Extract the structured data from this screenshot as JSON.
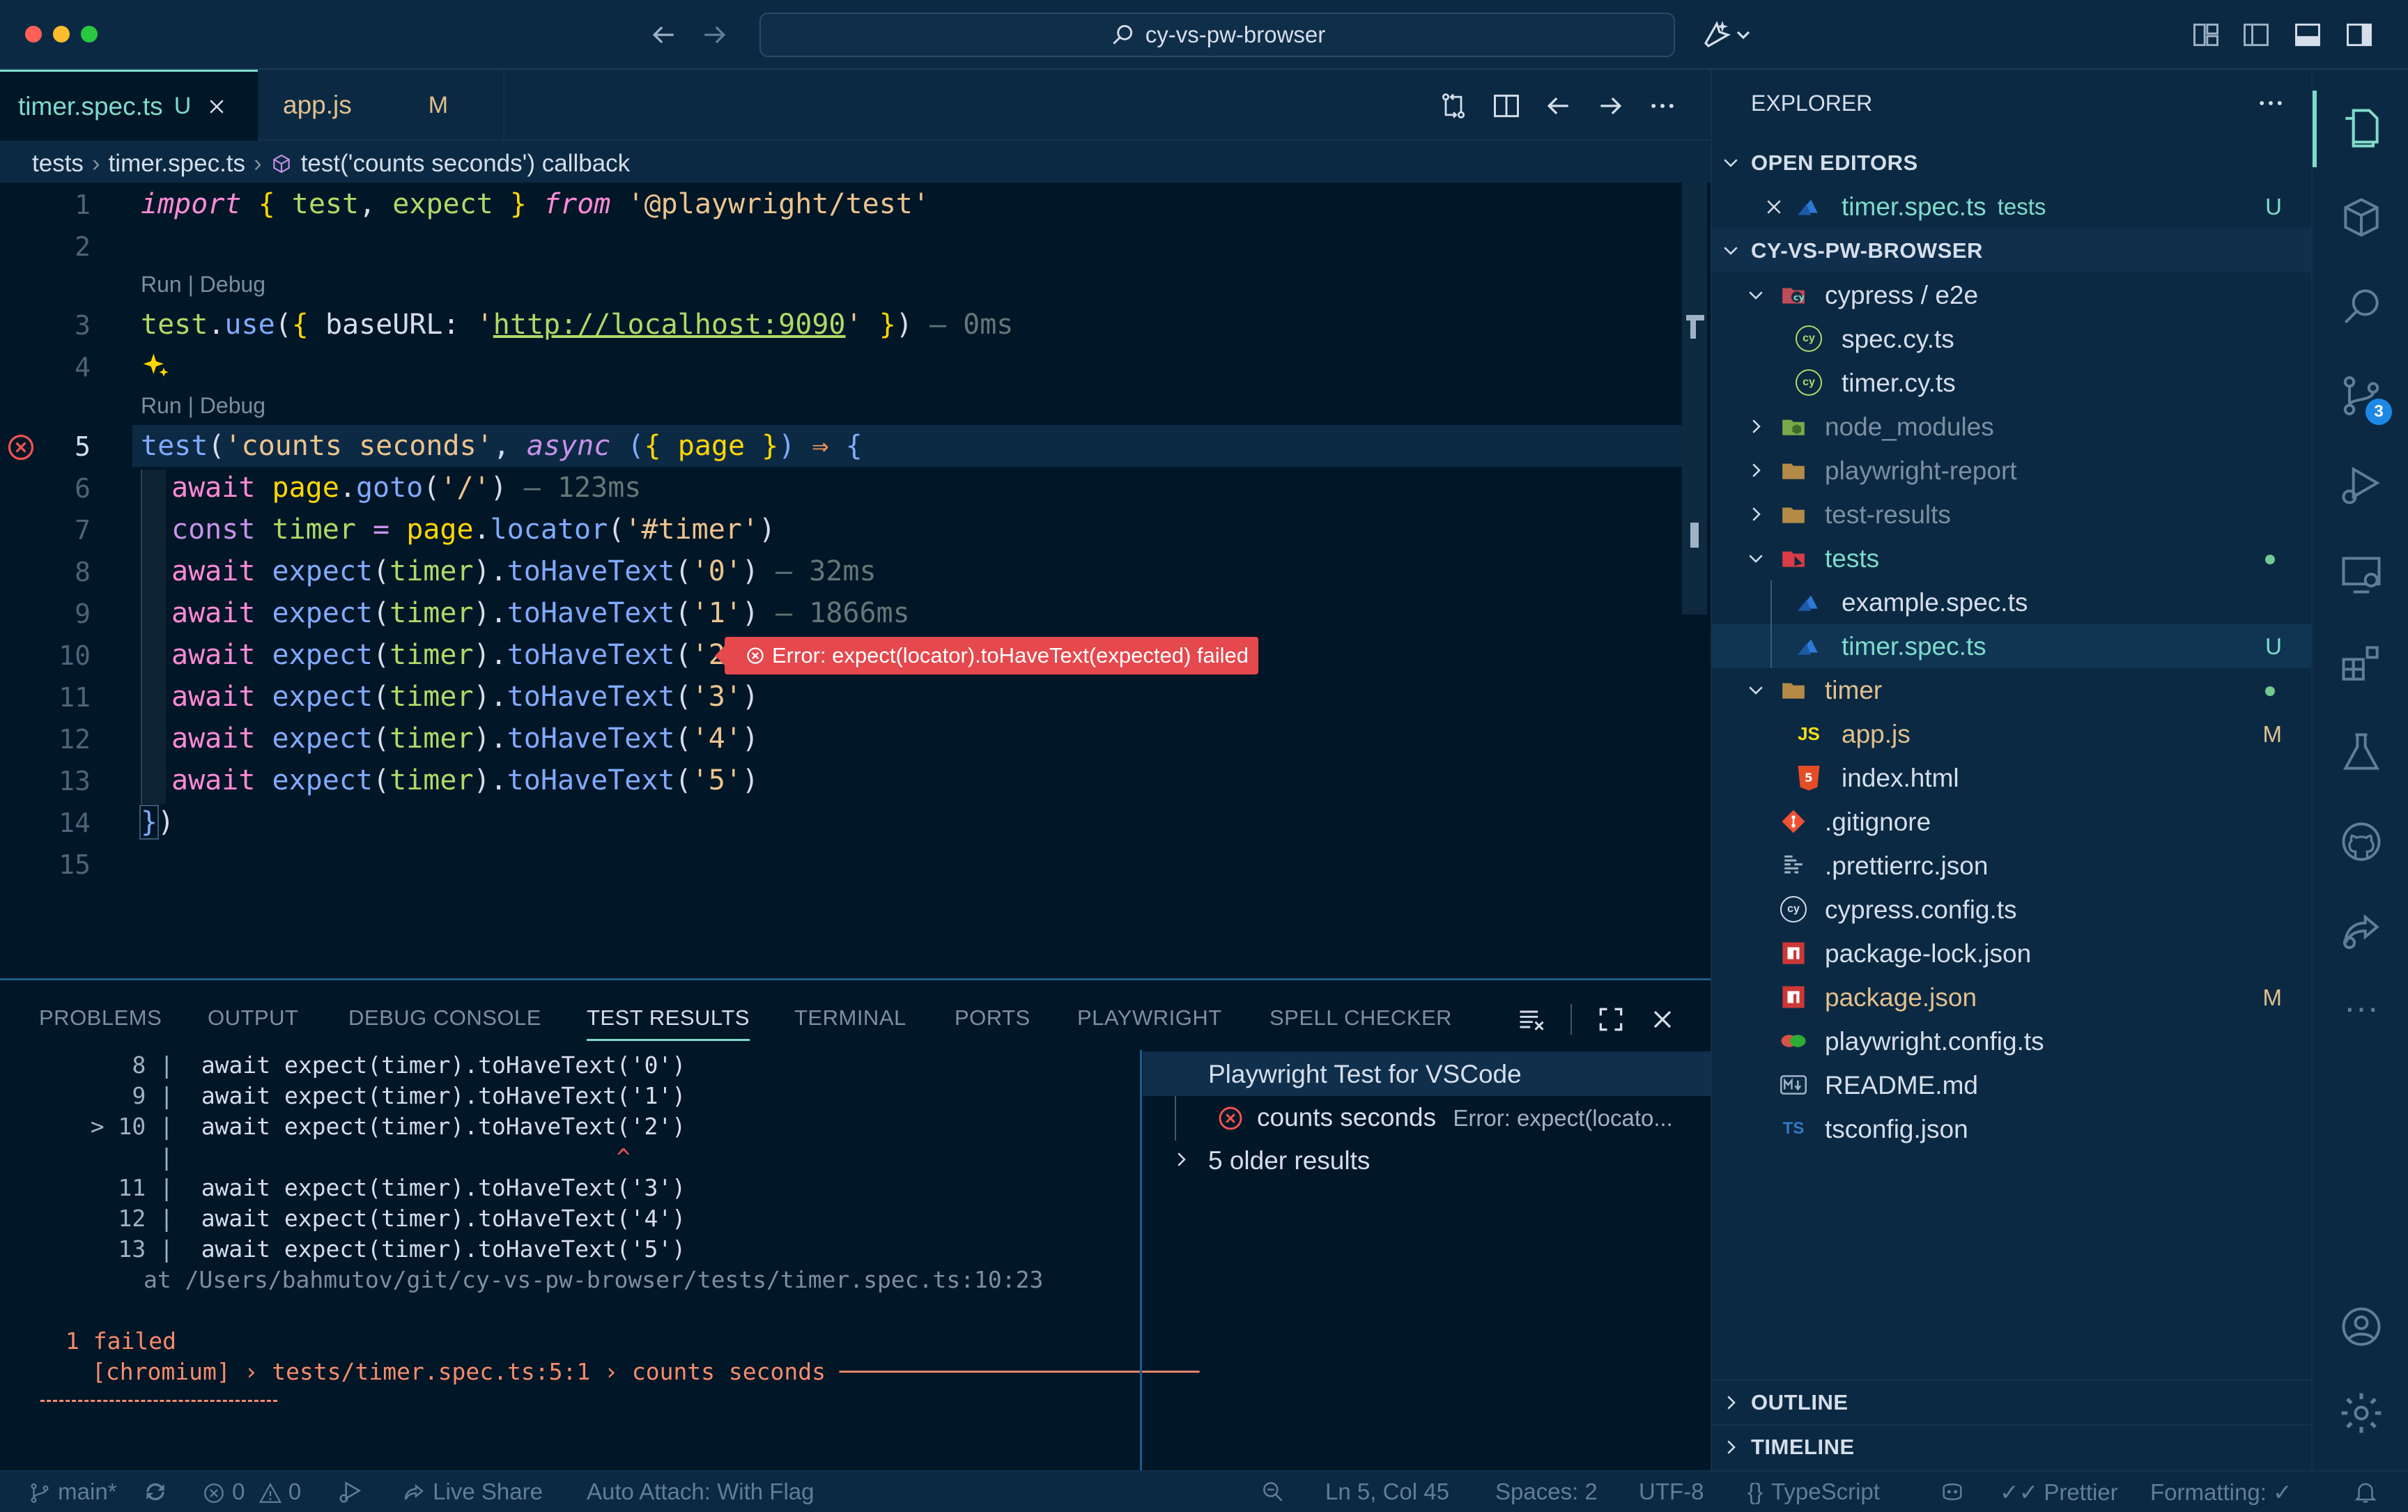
{
  "window": {
    "search_text": "cy-vs-pw-browser"
  },
  "tabs": [
    {
      "label": "timer.spec.ts",
      "status": "U",
      "active": true
    },
    {
      "label": "app.js",
      "status": "M",
      "active": false
    }
  ],
  "breadcrumb": [
    "tests",
    "timer.spec.ts",
    "test('counts seconds') callback"
  ],
  "codelens": "Run | Debug",
  "editor": {
    "line_numbers": [
      "1",
      "2",
      "3",
      "4",
      "5",
      "6",
      "7",
      "8",
      "9",
      "10",
      "11",
      "12",
      "13",
      "14",
      "15"
    ],
    "inline_error": "Error: expect(locator).toHaveText(expected) failed",
    "durations": {
      "line3": " — 0ms",
      "line6": " — 123ms",
      "line8": " — 32ms",
      "line9": " — 1866ms"
    }
  },
  "panel": {
    "tabs": [
      "PROBLEMS",
      "OUTPUT",
      "DEBUG CONSOLE",
      "TEST RESULTS",
      "TERMINAL",
      "PORTS",
      "PLAYWRIGHT",
      "SPELL CHECKER"
    ],
    "active_tab": "TEST RESULTS",
    "output_lines": [
      {
        "gutter": "    8 |",
        "code": "  await expect(timer).toHaveText('0')"
      },
      {
        "gutter": "    9 |",
        "code": "  await expect(timer).toHaveText('1')"
      },
      {
        "gutter": "  > 10 |",
        "code": "  await expect(timer).toHaveText('2')"
      },
      {
        "gutter": "       |",
        "code": "                                ^"
      },
      {
        "gutter": "    11 |",
        "code": "  await expect(timer).toHaveText('3')"
      },
      {
        "gutter": "    12 |",
        "code": "  await expect(timer).toHaveText('4')"
      },
      {
        "gutter": "    13 |",
        "code": "  await expect(timer).toHaveText('5')"
      }
    ],
    "at_line": "at /Users/bahmutov/git/cy-vs-pw-browser/tests/timer.spec.ts:10:23",
    "failed_summary": "1 failed",
    "failed_detail": "[chromium] › tests/timer.spec.ts:5:1 › counts seconds ──────────────────────────",
    "results_tree": {
      "root": "Playwright Test for VSCode",
      "item_name": "counts seconds",
      "item_error": "Error: expect(locato...",
      "older": "5 older results"
    }
  },
  "explorer": {
    "title": "EXPLORER",
    "open_editors_label": "OPEN EDITORS",
    "open_editor": {
      "name": "timer.spec.ts",
      "folder": "tests",
      "status": "U"
    },
    "project_label": "CY-VS-PW-BROWSER",
    "tree": [
      {
        "name": "cypress / e2e",
        "depth": 0,
        "type": "folder-open",
        "icon": "cypress-folder-icon"
      },
      {
        "name": "spec.cy.ts",
        "depth": 1,
        "type": "file",
        "icon": "cypress-file-icon"
      },
      {
        "name": "timer.cy.ts",
        "depth": 1,
        "type": "file",
        "icon": "cypress-file-icon"
      },
      {
        "name": "node_modules",
        "depth": 0,
        "type": "folder-closed",
        "icon": "node-folder-icon"
      },
      {
        "name": "playwright-report",
        "depth": 0,
        "type": "folder-closed",
        "icon": "folder-icon"
      },
      {
        "name": "test-results",
        "depth": 0,
        "type": "folder-closed",
        "icon": "folder-icon"
      },
      {
        "name": "tests",
        "depth": 0,
        "type": "folder-open",
        "icon": "test-folder-icon",
        "status": "dot"
      },
      {
        "name": "example.spec.ts",
        "depth": 1,
        "type": "file",
        "icon": "playwright-icon"
      },
      {
        "name": "timer.spec.ts",
        "depth": 1,
        "type": "file",
        "icon": "playwright-icon",
        "status": "U",
        "selected": true
      },
      {
        "name": "timer",
        "depth": 0,
        "type": "folder-open",
        "icon": "folder-icon",
        "status": "dot"
      },
      {
        "name": "app.js",
        "depth": 1,
        "type": "file",
        "icon": "js-icon",
        "status": "M"
      },
      {
        "name": "index.html",
        "depth": 1,
        "type": "file",
        "icon": "html-icon"
      },
      {
        "name": ".gitignore",
        "depth": 0,
        "type": "file",
        "icon": "git-icon"
      },
      {
        "name": ".prettierrc.json",
        "depth": 0,
        "type": "file",
        "icon": "prettier-icon"
      },
      {
        "name": "cypress.config.ts",
        "depth": 0,
        "type": "file",
        "icon": "cypress-file-icon"
      },
      {
        "name": "package-lock.json",
        "depth": 0,
        "type": "file",
        "icon": "npm-icon"
      },
      {
        "name": "package.json",
        "depth": 0,
        "type": "file",
        "icon": "npm-icon",
        "status": "M"
      },
      {
        "name": "playwright.config.ts",
        "depth": 0,
        "type": "file",
        "icon": "playwright-config-icon"
      },
      {
        "name": "README.md",
        "depth": 0,
        "type": "file",
        "icon": "markdown-icon"
      },
      {
        "name": "tsconfig.json",
        "depth": 0,
        "type": "file",
        "icon": "ts-icon"
      }
    ],
    "outline_label": "OUTLINE",
    "timeline_label": "TIMELINE"
  },
  "activity": {
    "source_control_badge": "3"
  },
  "statusbar": {
    "branch": "main*",
    "errors": "0",
    "warnings": "0",
    "live_share": "Live Share",
    "auto_attach": "Auto Attach: With Flag",
    "position": "Ln 5, Col 45",
    "spaces": "Spaces: 2",
    "encoding": "UTF-8",
    "language": "TypeScript",
    "prettier": "Prettier",
    "formatting": "Formatting: ✓"
  },
  "colors": {
    "background": "#011627",
    "chrome": "#0b2942",
    "accent": "#7fdbca",
    "error": "#ef5350",
    "git_untracked": "#73c991"
  }
}
